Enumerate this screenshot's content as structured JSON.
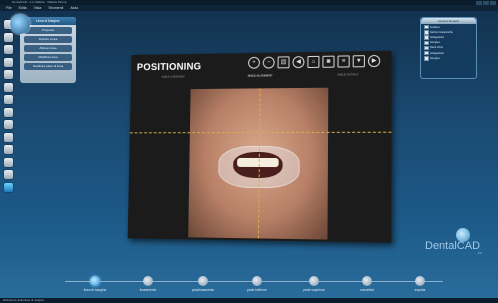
{
  "window": {
    "title": "DentalCAD - 2.2 Valletta - Valletta Sirona"
  },
  "menu": [
    "File",
    "Edita",
    "Vista",
    "Strumenti",
    "Aiuto"
  ],
  "left_tools": [
    "tool-1",
    "tool-2",
    "tool-3",
    "tool-4",
    "tool-5",
    "tool-6",
    "tool-7",
    "tool-8",
    "tool-9",
    "tool-10",
    "tool-11",
    "tool-12",
    "tool-13",
    "tool-14"
  ],
  "nav_panel": {
    "title": "Linea di Margine",
    "items": [
      "Proposta",
      "Definire Linea",
      "Allinea Linea",
      "Modifica Linea",
      "Sostituire parte di linea"
    ]
  },
  "right_panel": {
    "title": "Libreria Modello",
    "items": [
      "Scultura",
      "Sezioni Anatomiche",
      "Antagonista",
      "Gengiva",
      "Denti Vicini",
      "Antagonista",
      "Gengiva"
    ]
  },
  "positioning": {
    "title": "POSITIONING",
    "subtabs": [
      "SMILE OVERVIEW",
      "SMILE ALIGNMENT",
      "SMILE DETAILS"
    ],
    "toolbar_icons": [
      "zoom-in-icon",
      "zoom-out-icon",
      "trash-icon",
      "arrow-left-icon",
      "home-icon",
      "camera-icon",
      "layers-icon",
      "dropdown-icon",
      "arrow-right-icon"
    ]
  },
  "brand": {
    "name": "DentalCAD",
    "version": "2.2"
  },
  "timeline": {
    "steps": [
      "linea di margine",
      "inserimento",
      "posizionamento",
      "parte inferiore",
      "parte superiore",
      "connettori",
      "esporta"
    ],
    "active_index": 0
  },
  "status": {
    "text": "Definizione della linea di margine"
  }
}
